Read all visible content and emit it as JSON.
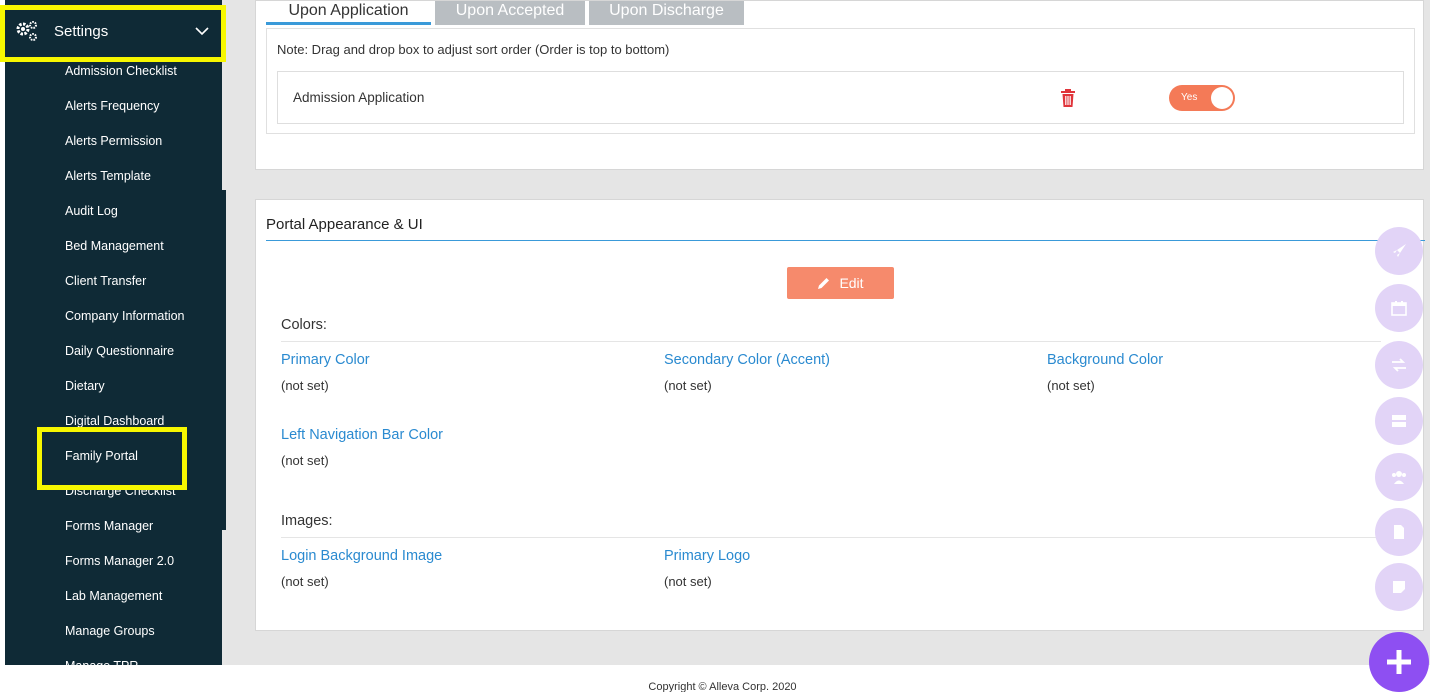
{
  "sidebar": {
    "header_label": "Settings",
    "items": [
      {
        "label": "Admission Checklist"
      },
      {
        "label": "Alerts Frequency"
      },
      {
        "label": "Alerts Permission"
      },
      {
        "label": "Alerts Template"
      },
      {
        "label": "Audit Log"
      },
      {
        "label": "Bed Management"
      },
      {
        "label": "Client Transfer"
      },
      {
        "label": "Company Information"
      },
      {
        "label": "Daily Questionnaire"
      },
      {
        "label": "Dietary"
      },
      {
        "label": "Digital Dashboard"
      },
      {
        "label": "Family Portal"
      },
      {
        "label": "Discharge Checklist"
      },
      {
        "label": "Forms Manager"
      },
      {
        "label": "Forms Manager 2.0"
      },
      {
        "label": "Lab Management"
      },
      {
        "label": "Manage Groups"
      },
      {
        "label": "Manage TPR"
      }
    ],
    "highlight_color": "#f7f700"
  },
  "tabs": [
    {
      "label": "Upon Application"
    },
    {
      "label": "Upon Accepted"
    },
    {
      "label": "Upon Discharge"
    }
  ],
  "checklist": {
    "note": "Note: Drag and drop box to adjust sort order (Order is top to bottom)",
    "items": [
      {
        "label": "Admission Application",
        "toggle_label": "Yes",
        "enabled": true
      }
    ]
  },
  "appearance": {
    "title": "Portal Appearance & UI",
    "edit_label": "Edit",
    "colors_label": "Colors:",
    "colors": [
      {
        "label": "Primary Color",
        "value": "(not set)"
      },
      {
        "label": "Secondary Color (Accent)",
        "value": "(not set)"
      },
      {
        "label": "Background Color",
        "value": "(not set)"
      },
      {
        "label": "Left Navigation Bar Color",
        "value": "(not set)"
      }
    ],
    "images_label": "Images:",
    "images": [
      {
        "label": "Login Background Image",
        "value": "(not set)"
      },
      {
        "label": "Primary Logo",
        "value": "(not set)"
      }
    ]
  },
  "fab": {
    "icons": [
      "rocket-icon",
      "calendar-icon",
      "transfer-icon",
      "server-icon",
      "users-icon",
      "document-icon",
      "note-icon"
    ],
    "main_icon": "plus-icon"
  },
  "footer": {
    "text": "Copyright © Alleva Corp. 2020"
  },
  "colors": {
    "sidebar_bg": "#0f2a36",
    "accent_orange": "#f47a57",
    "link_blue": "#2a8ad0",
    "fab_purple": "#8e4ff2"
  }
}
